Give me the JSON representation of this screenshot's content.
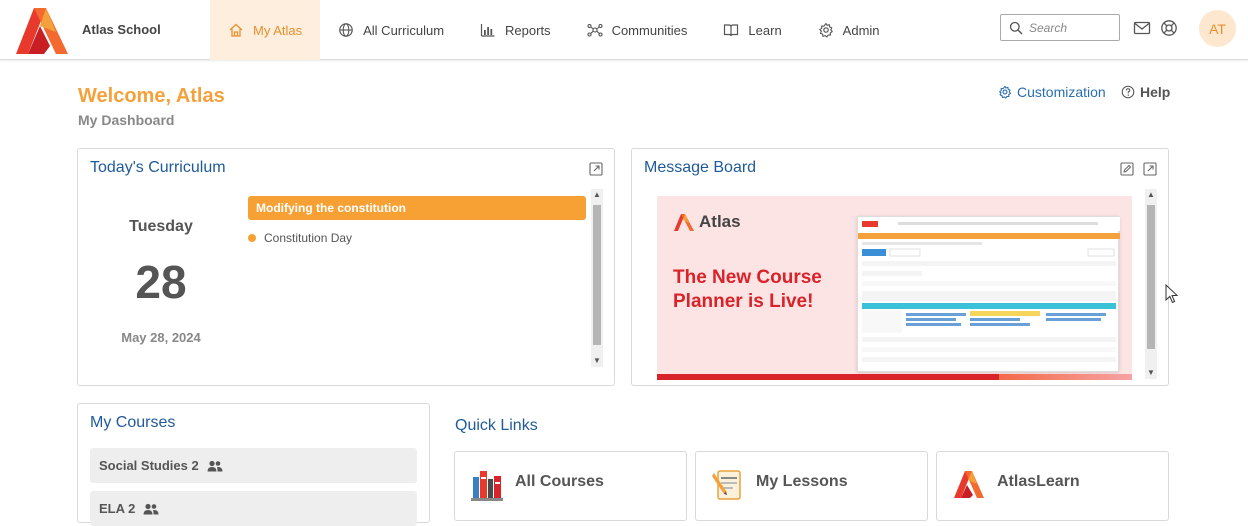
{
  "brand": {
    "name": "Atlas School",
    "logo_icon": "atlas-logo-icon",
    "colors": {
      "primary": "#e8392d",
      "secondary": "#f5a13b"
    }
  },
  "nav": {
    "items": [
      {
        "label": "My Atlas",
        "icon": "home-icon",
        "active": true
      },
      {
        "label": "All Curriculum",
        "icon": "globe-icon"
      },
      {
        "label": "Reports",
        "icon": "bar-chart-icon"
      },
      {
        "label": "Communities",
        "icon": "network-icon"
      },
      {
        "label": "Learn",
        "icon": "book-icon"
      },
      {
        "label": "Admin",
        "icon": "gear-icon"
      }
    ],
    "active_color": "#e8912c"
  },
  "search": {
    "placeholder": "Search",
    "icon": "search-icon"
  },
  "user": {
    "initials": "AT"
  },
  "header": {
    "welcome": "Welcome, Atlas",
    "subtitle": "My Dashboard",
    "customization_label": "Customization",
    "help_label": "Help",
    "welcome_color": "#f5a13b"
  },
  "todays_curriculum": {
    "title": "Today's Curriculum",
    "day_name": "Tuesday",
    "day_number": "28",
    "date": "May 28, 2024",
    "event_title": "Modifying the constitution",
    "event_item": "Constitution Day",
    "event_color": "#f7a034"
  },
  "message_board": {
    "title": "Message Board",
    "image_brand": "Atlas",
    "image_headline": "The New Course Planner is Live!",
    "headline_color": "#d8232a"
  },
  "my_courses": {
    "title": "My Courses",
    "items": [
      {
        "label": "Social Studies 2"
      },
      {
        "label": "ELA 2"
      }
    ]
  },
  "quick_links": {
    "title": "Quick Links",
    "items": [
      {
        "label": "All Courses",
        "icon": "books-icon"
      },
      {
        "label": "My Lessons",
        "icon": "lesson-planning-icon"
      },
      {
        "label": "AtlasLearn",
        "icon": "atlas-logo-icon"
      }
    ]
  }
}
